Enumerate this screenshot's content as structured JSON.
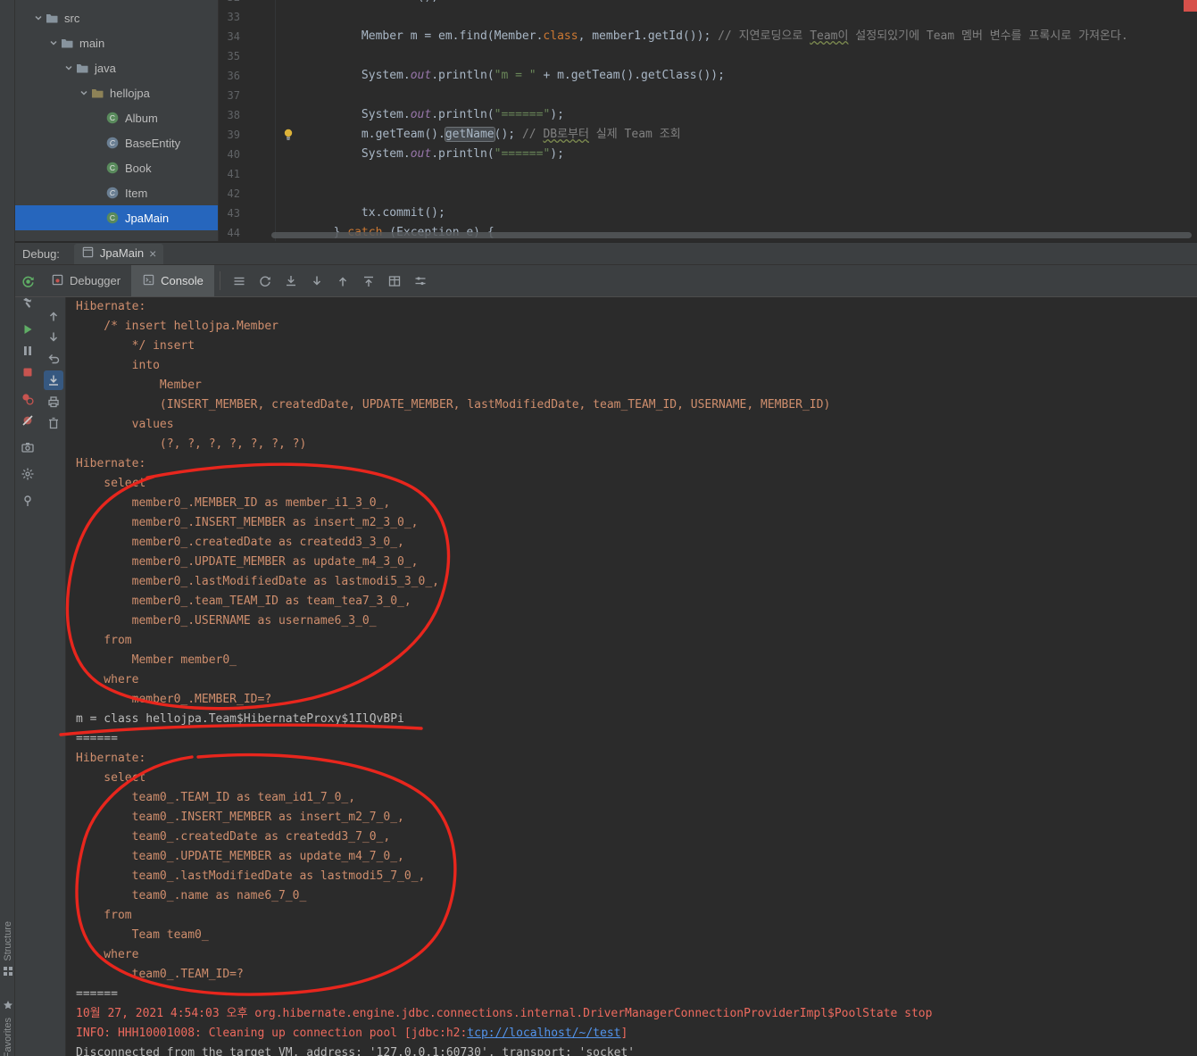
{
  "colors": {
    "accent_selection": "#2666bd",
    "sql": "#cf8e6d",
    "stdout": "#bcbcbc",
    "stderr": "#ed6a5e",
    "link": "#5394ec",
    "annotation": "#e8261d"
  },
  "tool_labels": {
    "structure": "Structure",
    "favorites": "Favorites"
  },
  "debug": {
    "label": "Debug:",
    "tab": {
      "title": "JpaMain",
      "close": "×"
    },
    "views": [
      {
        "label": "Debugger"
      },
      {
        "label": "Console",
        "selected": true
      }
    ]
  },
  "project_tree": {
    "items": [
      {
        "label": "src",
        "depth": 0,
        "icon": "folder",
        "expanded": true
      },
      {
        "label": "main",
        "depth": 1,
        "icon": "folder",
        "expanded": true
      },
      {
        "label": "java",
        "depth": 2,
        "icon": "folder",
        "expanded": true
      },
      {
        "label": "hellojpa",
        "depth": 3,
        "icon": "package",
        "expanded": true
      },
      {
        "label": "Album",
        "depth": 4,
        "icon": "class"
      },
      {
        "label": "BaseEntity",
        "depth": 4,
        "icon": "class-abstract"
      },
      {
        "label": "Book",
        "depth": 4,
        "icon": "class"
      },
      {
        "label": "Item",
        "depth": 4,
        "icon": "class-abstract"
      },
      {
        "label": "JpaMain",
        "depth": 4,
        "icon": "class",
        "selected": true
      }
    ]
  },
  "editor": {
    "lines": [
      {
        "no": 32,
        "segs": [
          {
            "t": "            em.clear();",
            "c": "d"
          }
        ]
      },
      {
        "no": 33,
        "segs": []
      },
      {
        "no": 34,
        "segs": [
          {
            "t": "            Member m = em.find(Member.",
            "c": "d"
          },
          {
            "t": "class",
            "c": "k"
          },
          {
            "t": ", member1.getId()); ",
            "c": "d"
          },
          {
            "t": "// 지연로딩으로 ",
            "c": "c"
          },
          {
            "t": "Team이",
            "c": "c",
            "u": true
          },
          {
            "t": " 설정되있기에 Team 멤버 변수를 프록시로 가져온다.",
            "c": "c"
          }
        ]
      },
      {
        "no": 35,
        "segs": []
      },
      {
        "no": 36,
        "segs": [
          {
            "t": "            System.",
            "c": "d"
          },
          {
            "t": "out",
            "c": "f"
          },
          {
            "t": ".println(",
            "c": "d"
          },
          {
            "t": "\"m = \"",
            "c": "s"
          },
          {
            "t": " + m.getTeam().getClass());",
            "c": "d"
          }
        ]
      },
      {
        "no": 37,
        "segs": []
      },
      {
        "no": 38,
        "segs": [
          {
            "t": "            System.",
            "c": "d"
          },
          {
            "t": "out",
            "c": "f"
          },
          {
            "t": ".println(",
            "c": "d"
          },
          {
            "t": "\"======\"",
            "c": "s"
          },
          {
            "t": ");",
            "c": "d"
          }
        ]
      },
      {
        "no": 39,
        "bulb": true,
        "segs": [
          {
            "t": "            m.getTeam().",
            "c": "d"
          },
          {
            "t": "getName",
            "c": "d",
            "hl": true
          },
          {
            "t": "(); ",
            "c": "d"
          },
          {
            "t": "// ",
            "c": "c"
          },
          {
            "t": "DB로부터",
            "c": "c",
            "u": true
          },
          {
            "t": " 실제 Team 조회",
            "c": "c"
          }
        ]
      },
      {
        "no": 40,
        "segs": [
          {
            "t": "            System.",
            "c": "d"
          },
          {
            "t": "out",
            "c": "f"
          },
          {
            "t": ".println(",
            "c": "d"
          },
          {
            "t": "\"======\"",
            "c": "s"
          },
          {
            "t": ");",
            "c": "d"
          }
        ]
      },
      {
        "no": 41,
        "segs": []
      },
      {
        "no": 42,
        "segs": []
      },
      {
        "no": 43,
        "segs": [
          {
            "t": "            tx.commit();",
            "c": "d"
          }
        ]
      },
      {
        "no": 44,
        "segs": [
          {
            "t": "        } ",
            "c": "d"
          },
          {
            "t": "catch",
            "c": "k"
          },
          {
            "t": " (Exception e) {",
            "c": "d"
          }
        ]
      }
    ]
  },
  "console_toolbar": [
    {
      "name": "menu"
    },
    {
      "name": "rerun"
    },
    {
      "name": "down-to-line"
    },
    {
      "name": "step-down"
    },
    {
      "name": "step-up"
    },
    {
      "name": "up-from-line"
    },
    {
      "name": "table"
    },
    {
      "name": "filter"
    }
  ],
  "debug_controls": {
    "strip_a": [
      {
        "name": "rerun-debug"
      },
      {
        "name": "build"
      },
      {
        "name": "resume",
        "gap": true
      },
      {
        "name": "pause"
      },
      {
        "name": "stop"
      },
      {
        "name": "view-breakpoints",
        "gap": true
      },
      {
        "name": "mute-breakpoints"
      },
      {
        "name": "screenshot",
        "gap": true
      },
      {
        "name": "settings-gear",
        "gap": true
      },
      {
        "name": "pin",
        "gap": true
      }
    ],
    "strip_b": [
      {
        "name": "step-up"
      },
      {
        "name": "step-down"
      },
      {
        "name": "reset-frame"
      },
      {
        "name": "scroll-to-end",
        "selected": true
      },
      {
        "name": "print"
      },
      {
        "name": "clear-all"
      }
    ]
  },
  "console": {
    "lines": [
      {
        "type": "sql",
        "text": "Hibernate: "
      },
      {
        "type": "sql",
        "text": "    /* insert hellojpa.Member"
      },
      {
        "type": "sql",
        "text": "        */ insert "
      },
      {
        "type": "sql",
        "text": "        into"
      },
      {
        "type": "sql",
        "text": "            Member"
      },
      {
        "type": "sql",
        "text": "            (INSERT_MEMBER, createdDate, UPDATE_MEMBER, lastModifiedDate, team_TEAM_ID, USERNAME, MEMBER_ID) "
      },
      {
        "type": "sql",
        "text": "        values"
      },
      {
        "type": "sql",
        "text": "            (?, ?, ?, ?, ?, ?, ?)"
      },
      {
        "type": "sql",
        "text": "Hibernate: "
      },
      {
        "type": "sql",
        "text": "    select"
      },
      {
        "type": "sql",
        "text": "        member0_.MEMBER_ID as member_i1_3_0_,"
      },
      {
        "type": "sql",
        "text": "        member0_.INSERT_MEMBER as insert_m2_3_0_,"
      },
      {
        "type": "sql",
        "text": "        member0_.createdDate as createdd3_3_0_,"
      },
      {
        "type": "sql",
        "text": "        member0_.UPDATE_MEMBER as update_m4_3_0_,"
      },
      {
        "type": "sql",
        "text": "        member0_.lastModifiedDate as lastmodi5_3_0_,"
      },
      {
        "type": "sql",
        "text": "        member0_.team_TEAM_ID as team_tea7_3_0_,"
      },
      {
        "type": "sql",
        "text": "        member0_.USERNAME as username6_3_0_ "
      },
      {
        "type": "sql",
        "text": "    from"
      },
      {
        "type": "sql",
        "text": "        Member member0_ "
      },
      {
        "type": "sql",
        "text": "    where"
      },
      {
        "type": "sql",
        "text": "        member0_.MEMBER_ID=?"
      },
      {
        "type": "out",
        "text": "m = class hellojpa.Team$HibernateProxy$1IlQvBPi"
      },
      {
        "type": "out",
        "text": "======"
      },
      {
        "type": "sql",
        "text": "Hibernate: "
      },
      {
        "type": "sql",
        "text": "    select"
      },
      {
        "type": "sql",
        "text": "        team0_.TEAM_ID as team_id1_7_0_,"
      },
      {
        "type": "sql",
        "text": "        team0_.INSERT_MEMBER as insert_m2_7_0_,"
      },
      {
        "type": "sql",
        "text": "        team0_.createdDate as createdd3_7_0_,"
      },
      {
        "type": "sql",
        "text": "        team0_.UPDATE_MEMBER as update_m4_7_0_,"
      },
      {
        "type": "sql",
        "text": "        team0_.lastModifiedDate as lastmodi5_7_0_,"
      },
      {
        "type": "sql",
        "text": "        team0_.name as name6_7_0_ "
      },
      {
        "type": "sql",
        "text": "    from"
      },
      {
        "type": "sql",
        "text": "        Team team0_ "
      },
      {
        "type": "sql",
        "text": "    where"
      },
      {
        "type": "sql",
        "text": "        team0_.TEAM_ID=?"
      },
      {
        "type": "out",
        "text": "======"
      },
      {
        "type": "err",
        "text": "10월 27, 2021 4:54:03 오후 org.hibernate.engine.jdbc.connections.internal.DriverManagerConnectionProviderImpl$PoolState stop"
      },
      {
        "type": "err",
        "segments": [
          {
            "t": "INFO: HHH10001008: Cleaning up connection pool [jdbc:h2:",
            "type": "err"
          },
          {
            "t": "tcp://localhost/~/test",
            "type": "link"
          },
          {
            "t": "]",
            "type": "err"
          }
        ]
      },
      {
        "type": "out",
        "text": "Disconnected from the target VM, address: '127.0.0.1:60730', transport: 'socket'"
      }
    ]
  }
}
